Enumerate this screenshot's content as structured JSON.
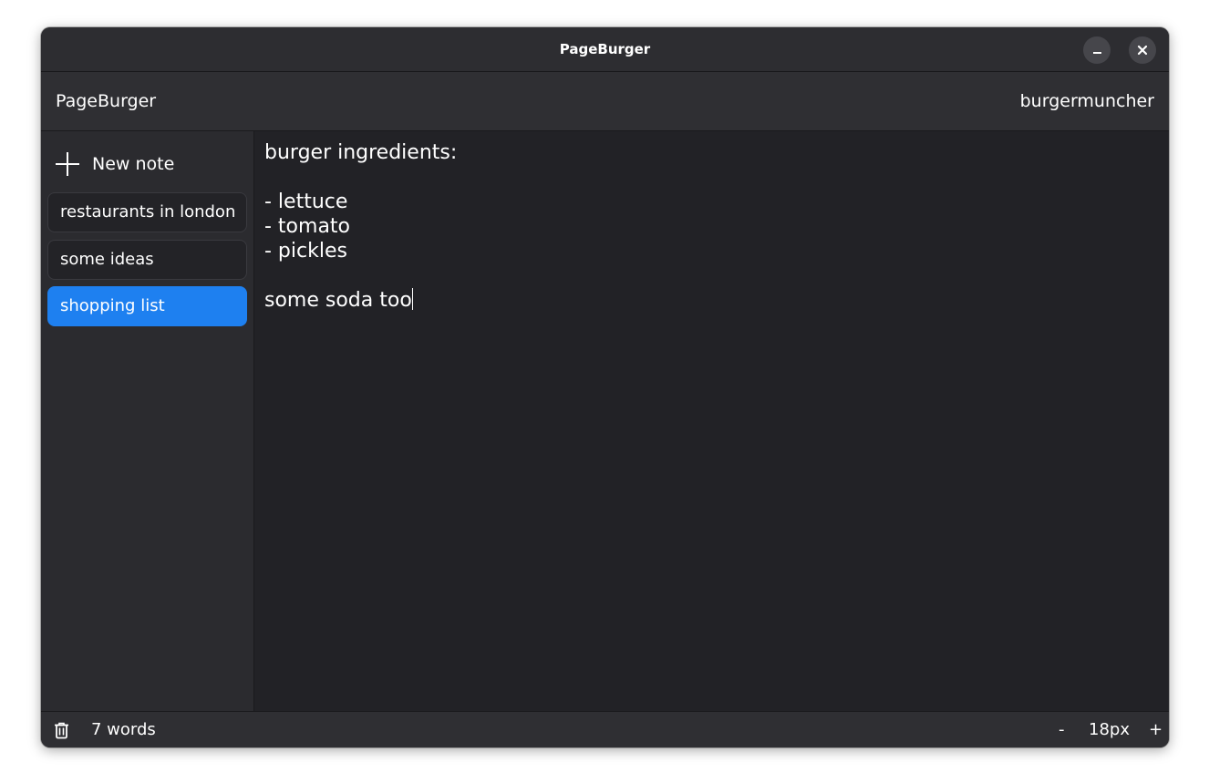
{
  "window": {
    "title": "PageBurger",
    "minimize_icon": "minimize-icon",
    "close_icon": "close-icon"
  },
  "header": {
    "app_name": "PageBurger",
    "username": "burgermuncher"
  },
  "sidebar": {
    "new_note_label": "New note",
    "new_note_icon": "plus-icon",
    "notes": [
      {
        "title": "restaurants in london",
        "active": false
      },
      {
        "title": "some ideas",
        "active": false
      },
      {
        "title": "shopping list",
        "active": true
      }
    ]
  },
  "editor": {
    "content": "burger ingredients:\n\n- lettuce\n- tomato\n- pickles\n\nsome soda too"
  },
  "status": {
    "trash_icon": "trash-icon",
    "word_count": "7 words",
    "zoom_out": "-",
    "font_size": "18px",
    "zoom_in": "+"
  },
  "colors": {
    "accent": "#1e80f0",
    "background": "#222226",
    "sidebar": "#2b2b2f",
    "header": "#2f2f33"
  }
}
